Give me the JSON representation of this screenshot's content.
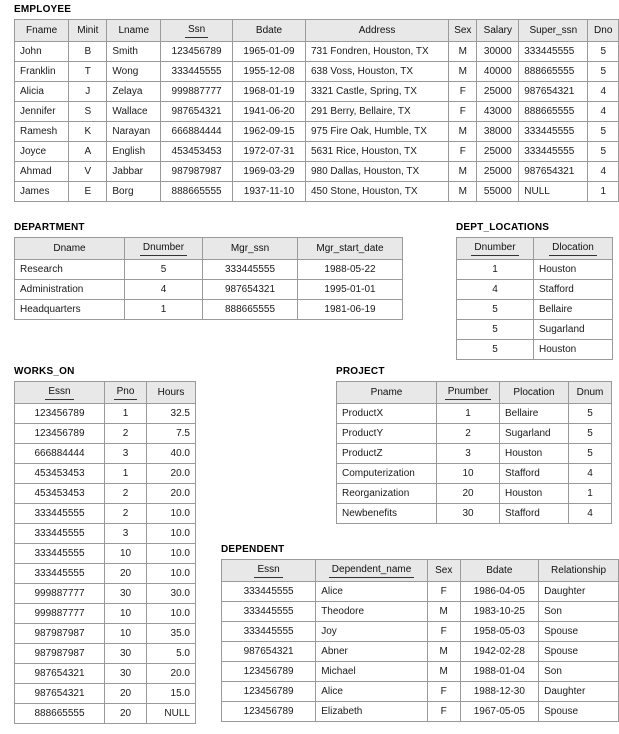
{
  "tables": {
    "employee": {
      "title": "EMPLOYEE",
      "columns": [
        {
          "label": "Fname",
          "key": false,
          "align": "l"
        },
        {
          "label": "Minit",
          "key": false,
          "align": "c"
        },
        {
          "label": "Lname",
          "key": false,
          "align": "l"
        },
        {
          "label": "Ssn",
          "key": true,
          "align": "c"
        },
        {
          "label": "Bdate",
          "key": false,
          "align": "c"
        },
        {
          "label": "Address",
          "key": false,
          "align": "l"
        },
        {
          "label": "Sex",
          "key": false,
          "align": "c"
        },
        {
          "label": "Salary",
          "key": false,
          "align": "c"
        },
        {
          "label": "Super_ssn",
          "key": false,
          "align": "l"
        },
        {
          "label": "Dno",
          "key": false,
          "align": "c"
        }
      ],
      "rows": [
        [
          "John",
          "B",
          "Smith",
          "123456789",
          "1965-01-09",
          "731 Fondren, Houston, TX",
          "M",
          "30000",
          "333445555",
          "5"
        ],
        [
          "Franklin",
          "T",
          "Wong",
          "333445555",
          "1955-12-08",
          "638 Voss, Houston, TX",
          "M",
          "40000",
          "888665555",
          "5"
        ],
        [
          "Alicia",
          "J",
          "Zelaya",
          "999887777",
          "1968-01-19",
          "3321 Castle, Spring, TX",
          "F",
          "25000",
          "987654321",
          "4"
        ],
        [
          "Jennifer",
          "S",
          "Wallace",
          "987654321",
          "1941-06-20",
          "291 Berry, Bellaire, TX",
          "F",
          "43000",
          "888665555",
          "4"
        ],
        [
          "Ramesh",
          "K",
          "Narayan",
          "666884444",
          "1962-09-15",
          "975 Fire Oak, Humble, TX",
          "M",
          "38000",
          "333445555",
          "5"
        ],
        [
          "Joyce",
          "A",
          "English",
          "453453453",
          "1972-07-31",
          "5631 Rice, Houston, TX",
          "F",
          "25000",
          "333445555",
          "5"
        ],
        [
          "Ahmad",
          "V",
          "Jabbar",
          "987987987",
          "1969-03-29",
          "980 Dallas, Houston, TX",
          "M",
          "25000",
          "987654321",
          "4"
        ],
        [
          "James",
          "E",
          "Borg",
          "888665555",
          "1937-11-10",
          "450 Stone, Houston, TX",
          "M",
          "55000",
          "NULL",
          "1"
        ]
      ]
    },
    "department": {
      "title": "DEPARTMENT",
      "columns": [
        {
          "label": "Dname",
          "key": false,
          "align": "l"
        },
        {
          "label": "Dnumber",
          "key": true,
          "align": "c"
        },
        {
          "label": "Mgr_ssn",
          "key": false,
          "align": "c"
        },
        {
          "label": "Mgr_start_date",
          "key": false,
          "align": "c"
        }
      ],
      "rows": [
        [
          "Research",
          "5",
          "333445555",
          "1988-05-22"
        ],
        [
          "Administration",
          "4",
          "987654321",
          "1995-01-01"
        ],
        [
          "Headquarters",
          "1",
          "888665555",
          "1981-06-19"
        ]
      ]
    },
    "dept_locations": {
      "title": "DEPT_LOCATIONS",
      "columns": [
        {
          "label": "Dnumber",
          "key": true,
          "align": "c"
        },
        {
          "label": "Dlocation",
          "key": true,
          "align": "l"
        }
      ],
      "rows": [
        [
          "1",
          "Houston"
        ],
        [
          "4",
          "Stafford"
        ],
        [
          "5",
          "Bellaire"
        ],
        [
          "5",
          "Sugarland"
        ],
        [
          "5",
          "Houston"
        ]
      ]
    },
    "works_on": {
      "title": "WORKS_ON",
      "columns": [
        {
          "label": "Essn",
          "key": true,
          "align": "c"
        },
        {
          "label": "Pno",
          "key": true,
          "align": "c"
        },
        {
          "label": "Hours",
          "key": false,
          "align": "r"
        }
      ],
      "rows": [
        [
          "123456789",
          "1",
          "32.5"
        ],
        [
          "123456789",
          "2",
          "7.5"
        ],
        [
          "666884444",
          "3",
          "40.0"
        ],
        [
          "453453453",
          "1",
          "20.0"
        ],
        [
          "453453453",
          "2",
          "20.0"
        ],
        [
          "333445555",
          "2",
          "10.0"
        ],
        [
          "333445555",
          "3",
          "10.0"
        ],
        [
          "333445555",
          "10",
          "10.0"
        ],
        [
          "333445555",
          "20",
          "10.0"
        ],
        [
          "999887777",
          "30",
          "30.0"
        ],
        [
          "999887777",
          "10",
          "10.0"
        ],
        [
          "987987987",
          "10",
          "35.0"
        ],
        [
          "987987987",
          "30",
          "5.0"
        ],
        [
          "987654321",
          "30",
          "20.0"
        ],
        [
          "987654321",
          "20",
          "15.0"
        ],
        [
          "888665555",
          "20",
          "NULL"
        ]
      ]
    },
    "project": {
      "title": "PROJECT",
      "columns": [
        {
          "label": "Pname",
          "key": false,
          "align": "l"
        },
        {
          "label": "Pnumber",
          "key": true,
          "align": "c"
        },
        {
          "label": "Plocation",
          "key": false,
          "align": "l"
        },
        {
          "label": "Dnum",
          "key": false,
          "align": "c"
        }
      ],
      "rows": [
        [
          "ProductX",
          "1",
          "Bellaire",
          "5"
        ],
        [
          "ProductY",
          "2",
          "Sugarland",
          "5"
        ],
        [
          "ProductZ",
          "3",
          "Houston",
          "5"
        ],
        [
          "Computerization",
          "10",
          "Stafford",
          "4"
        ],
        [
          "Reorganization",
          "20",
          "Houston",
          "1"
        ],
        [
          "Newbenefits",
          "30",
          "Stafford",
          "4"
        ]
      ]
    },
    "dependent": {
      "title": "DEPENDENT",
      "columns": [
        {
          "label": "Essn",
          "key": true,
          "align": "c"
        },
        {
          "label": "Dependent_name",
          "key": true,
          "align": "l"
        },
        {
          "label": "Sex",
          "key": false,
          "align": "c"
        },
        {
          "label": "Bdate",
          "key": false,
          "align": "c"
        },
        {
          "label": "Relationship",
          "key": false,
          "align": "l"
        }
      ],
      "rows": [
        [
          "333445555",
          "Alice",
          "F",
          "1986-04-05",
          "Daughter"
        ],
        [
          "333445555",
          "Theodore",
          "M",
          "1983-10-25",
          "Son"
        ],
        [
          "333445555",
          "Joy",
          "F",
          "1958-05-03",
          "Spouse"
        ],
        [
          "987654321",
          "Abner",
          "M",
          "1942-02-28",
          "Spouse"
        ],
        [
          "123456789",
          "Michael",
          "M",
          "1988-01-04",
          "Son"
        ],
        [
          "123456789",
          "Alice",
          "F",
          "1988-12-30",
          "Daughter"
        ],
        [
          "123456789",
          "Elizabeth",
          "F",
          "1967-05-05",
          "Spouse"
        ]
      ]
    }
  }
}
